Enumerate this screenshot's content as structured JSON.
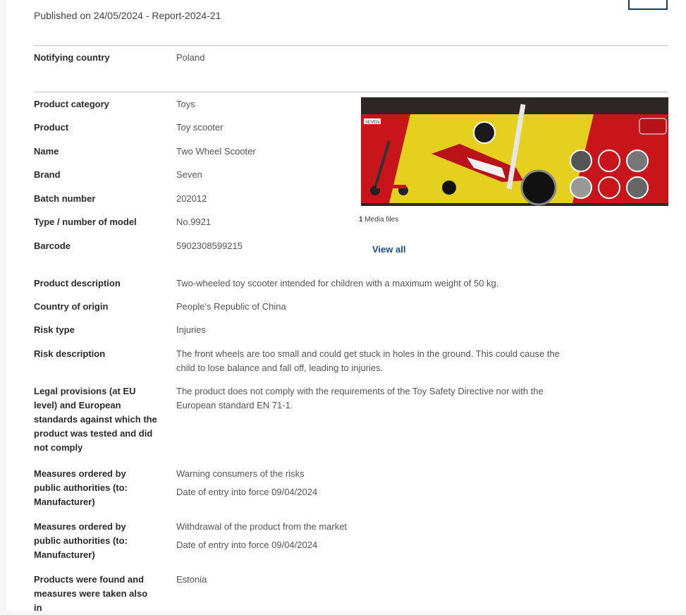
{
  "header": {
    "published_prefix": "Published on 24/05/2024",
    "separator": " - ",
    "report_id": "Report-2024-21"
  },
  "notifying": {
    "label": "Notifying country",
    "value": "Poland"
  },
  "product_info": [
    {
      "label": "Product category",
      "value": "Toys"
    },
    {
      "label": "Product",
      "value": "Toy scooter"
    },
    {
      "label": "Name",
      "value": "Two Wheel Scooter"
    },
    {
      "label": "Brand",
      "value": "Seven"
    },
    {
      "label": "Batch number",
      "value": "202012"
    },
    {
      "label": "Type / number of model",
      "value": "No.9921"
    },
    {
      "label": "Barcode",
      "value": "5902308599215"
    }
  ],
  "media": {
    "count": "1",
    "count_label": " Media files",
    "view_all": "View all"
  },
  "details": {
    "description": {
      "label": "Product description",
      "value": "Two-wheeled toy scooter intended for children with a maximum weight of 50 kg."
    },
    "origin": {
      "label": "Country of origin",
      "value": "People's Republic of China"
    },
    "risk_type": {
      "label": "Risk type",
      "value": "Injuries"
    },
    "risk_description": {
      "label": "Risk description",
      "value": "The front wheels are too small and could get stuck in holes in the ground. This could cause the child to lose balance and fall off, leading to injuries."
    },
    "legal": {
      "label": "Legal provisions (at EU level) and European standards against which the product was tested and did not comply",
      "value": "The product does not comply with the requirements of the Toy Safety Directive nor with the European standard EN 71-1."
    },
    "measures_1": {
      "label": "Measures ordered by public authorities (to: Manufacturer)",
      "measure": "Warning consumers of the risks",
      "date": "Date of entry into force 09/04/2024"
    },
    "measures_2": {
      "label": "Measures ordered by public authorities (to: Manufacturer)",
      "measure": "Withdrawal of the product from the market",
      "date": "Date of entry into force 09/04/2024"
    },
    "also_found": {
      "label": "Products were found and measures were taken also in",
      "value": "Estonia"
    }
  },
  "photo_packaging_text": {
    "brand_tag": "SEVEN"
  },
  "colors": {
    "link": "#1a4b8c",
    "rule": "#bdbdbd",
    "label": "#2b2b2b",
    "value": "#555555"
  }
}
